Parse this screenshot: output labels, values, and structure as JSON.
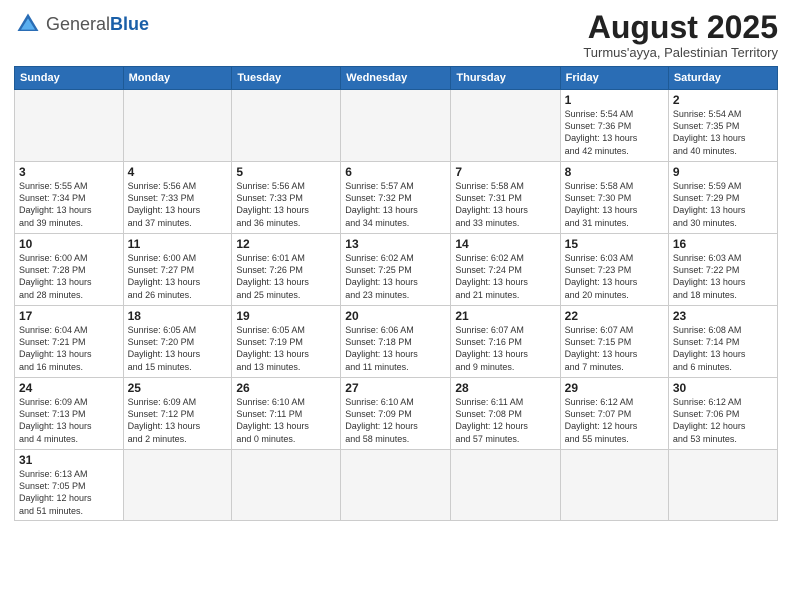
{
  "header": {
    "logo_general": "General",
    "logo_blue": "Blue",
    "month_title": "August 2025",
    "subtitle": "Turmus'ayya, Palestinian Territory"
  },
  "weekdays": [
    "Sunday",
    "Monday",
    "Tuesday",
    "Wednesday",
    "Thursday",
    "Friday",
    "Saturday"
  ],
  "weeks": [
    [
      {
        "day": "",
        "info": "",
        "empty": true
      },
      {
        "day": "",
        "info": "",
        "empty": true
      },
      {
        "day": "",
        "info": "",
        "empty": true
      },
      {
        "day": "",
        "info": "",
        "empty": true
      },
      {
        "day": "",
        "info": "",
        "empty": true
      },
      {
        "day": "1",
        "info": "Sunrise: 5:54 AM\nSunset: 7:36 PM\nDaylight: 13 hours\nand 42 minutes.",
        "empty": false
      },
      {
        "day": "2",
        "info": "Sunrise: 5:54 AM\nSunset: 7:35 PM\nDaylight: 13 hours\nand 40 minutes.",
        "empty": false
      }
    ],
    [
      {
        "day": "3",
        "info": "Sunrise: 5:55 AM\nSunset: 7:34 PM\nDaylight: 13 hours\nand 39 minutes.",
        "empty": false
      },
      {
        "day": "4",
        "info": "Sunrise: 5:56 AM\nSunset: 7:33 PM\nDaylight: 13 hours\nand 37 minutes.",
        "empty": false
      },
      {
        "day": "5",
        "info": "Sunrise: 5:56 AM\nSunset: 7:33 PM\nDaylight: 13 hours\nand 36 minutes.",
        "empty": false
      },
      {
        "day": "6",
        "info": "Sunrise: 5:57 AM\nSunset: 7:32 PM\nDaylight: 13 hours\nand 34 minutes.",
        "empty": false
      },
      {
        "day": "7",
        "info": "Sunrise: 5:58 AM\nSunset: 7:31 PM\nDaylight: 13 hours\nand 33 minutes.",
        "empty": false
      },
      {
        "day": "8",
        "info": "Sunrise: 5:58 AM\nSunset: 7:30 PM\nDaylight: 13 hours\nand 31 minutes.",
        "empty": false
      },
      {
        "day": "9",
        "info": "Sunrise: 5:59 AM\nSunset: 7:29 PM\nDaylight: 13 hours\nand 30 minutes.",
        "empty": false
      }
    ],
    [
      {
        "day": "10",
        "info": "Sunrise: 6:00 AM\nSunset: 7:28 PM\nDaylight: 13 hours\nand 28 minutes.",
        "empty": false
      },
      {
        "day": "11",
        "info": "Sunrise: 6:00 AM\nSunset: 7:27 PM\nDaylight: 13 hours\nand 26 minutes.",
        "empty": false
      },
      {
        "day": "12",
        "info": "Sunrise: 6:01 AM\nSunset: 7:26 PM\nDaylight: 13 hours\nand 25 minutes.",
        "empty": false
      },
      {
        "day": "13",
        "info": "Sunrise: 6:02 AM\nSunset: 7:25 PM\nDaylight: 13 hours\nand 23 minutes.",
        "empty": false
      },
      {
        "day": "14",
        "info": "Sunrise: 6:02 AM\nSunset: 7:24 PM\nDaylight: 13 hours\nand 21 minutes.",
        "empty": false
      },
      {
        "day": "15",
        "info": "Sunrise: 6:03 AM\nSunset: 7:23 PM\nDaylight: 13 hours\nand 20 minutes.",
        "empty": false
      },
      {
        "day": "16",
        "info": "Sunrise: 6:03 AM\nSunset: 7:22 PM\nDaylight: 13 hours\nand 18 minutes.",
        "empty": false
      }
    ],
    [
      {
        "day": "17",
        "info": "Sunrise: 6:04 AM\nSunset: 7:21 PM\nDaylight: 13 hours\nand 16 minutes.",
        "empty": false
      },
      {
        "day": "18",
        "info": "Sunrise: 6:05 AM\nSunset: 7:20 PM\nDaylight: 13 hours\nand 15 minutes.",
        "empty": false
      },
      {
        "day": "19",
        "info": "Sunrise: 6:05 AM\nSunset: 7:19 PM\nDaylight: 13 hours\nand 13 minutes.",
        "empty": false
      },
      {
        "day": "20",
        "info": "Sunrise: 6:06 AM\nSunset: 7:18 PM\nDaylight: 13 hours\nand 11 minutes.",
        "empty": false
      },
      {
        "day": "21",
        "info": "Sunrise: 6:07 AM\nSunset: 7:16 PM\nDaylight: 13 hours\nand 9 minutes.",
        "empty": false
      },
      {
        "day": "22",
        "info": "Sunrise: 6:07 AM\nSunset: 7:15 PM\nDaylight: 13 hours\nand 7 minutes.",
        "empty": false
      },
      {
        "day": "23",
        "info": "Sunrise: 6:08 AM\nSunset: 7:14 PM\nDaylight: 13 hours\nand 6 minutes.",
        "empty": false
      }
    ],
    [
      {
        "day": "24",
        "info": "Sunrise: 6:09 AM\nSunset: 7:13 PM\nDaylight: 13 hours\nand 4 minutes.",
        "empty": false
      },
      {
        "day": "25",
        "info": "Sunrise: 6:09 AM\nSunset: 7:12 PM\nDaylight: 13 hours\nand 2 minutes.",
        "empty": false
      },
      {
        "day": "26",
        "info": "Sunrise: 6:10 AM\nSunset: 7:11 PM\nDaylight: 13 hours\nand 0 minutes.",
        "empty": false
      },
      {
        "day": "27",
        "info": "Sunrise: 6:10 AM\nSunset: 7:09 PM\nDaylight: 12 hours\nand 58 minutes.",
        "empty": false
      },
      {
        "day": "28",
        "info": "Sunrise: 6:11 AM\nSunset: 7:08 PM\nDaylight: 12 hours\nand 57 minutes.",
        "empty": false
      },
      {
        "day": "29",
        "info": "Sunrise: 6:12 AM\nSunset: 7:07 PM\nDaylight: 12 hours\nand 55 minutes.",
        "empty": false
      },
      {
        "day": "30",
        "info": "Sunrise: 6:12 AM\nSunset: 7:06 PM\nDaylight: 12 hours\nand 53 minutes.",
        "empty": false
      }
    ],
    [
      {
        "day": "31",
        "info": "Sunrise: 6:13 AM\nSunset: 7:05 PM\nDaylight: 12 hours\nand 51 minutes.",
        "empty": false
      },
      {
        "day": "",
        "info": "",
        "empty": true
      },
      {
        "day": "",
        "info": "",
        "empty": true
      },
      {
        "day": "",
        "info": "",
        "empty": true
      },
      {
        "day": "",
        "info": "",
        "empty": true
      },
      {
        "day": "",
        "info": "",
        "empty": true
      },
      {
        "day": "",
        "info": "",
        "empty": true
      }
    ]
  ]
}
